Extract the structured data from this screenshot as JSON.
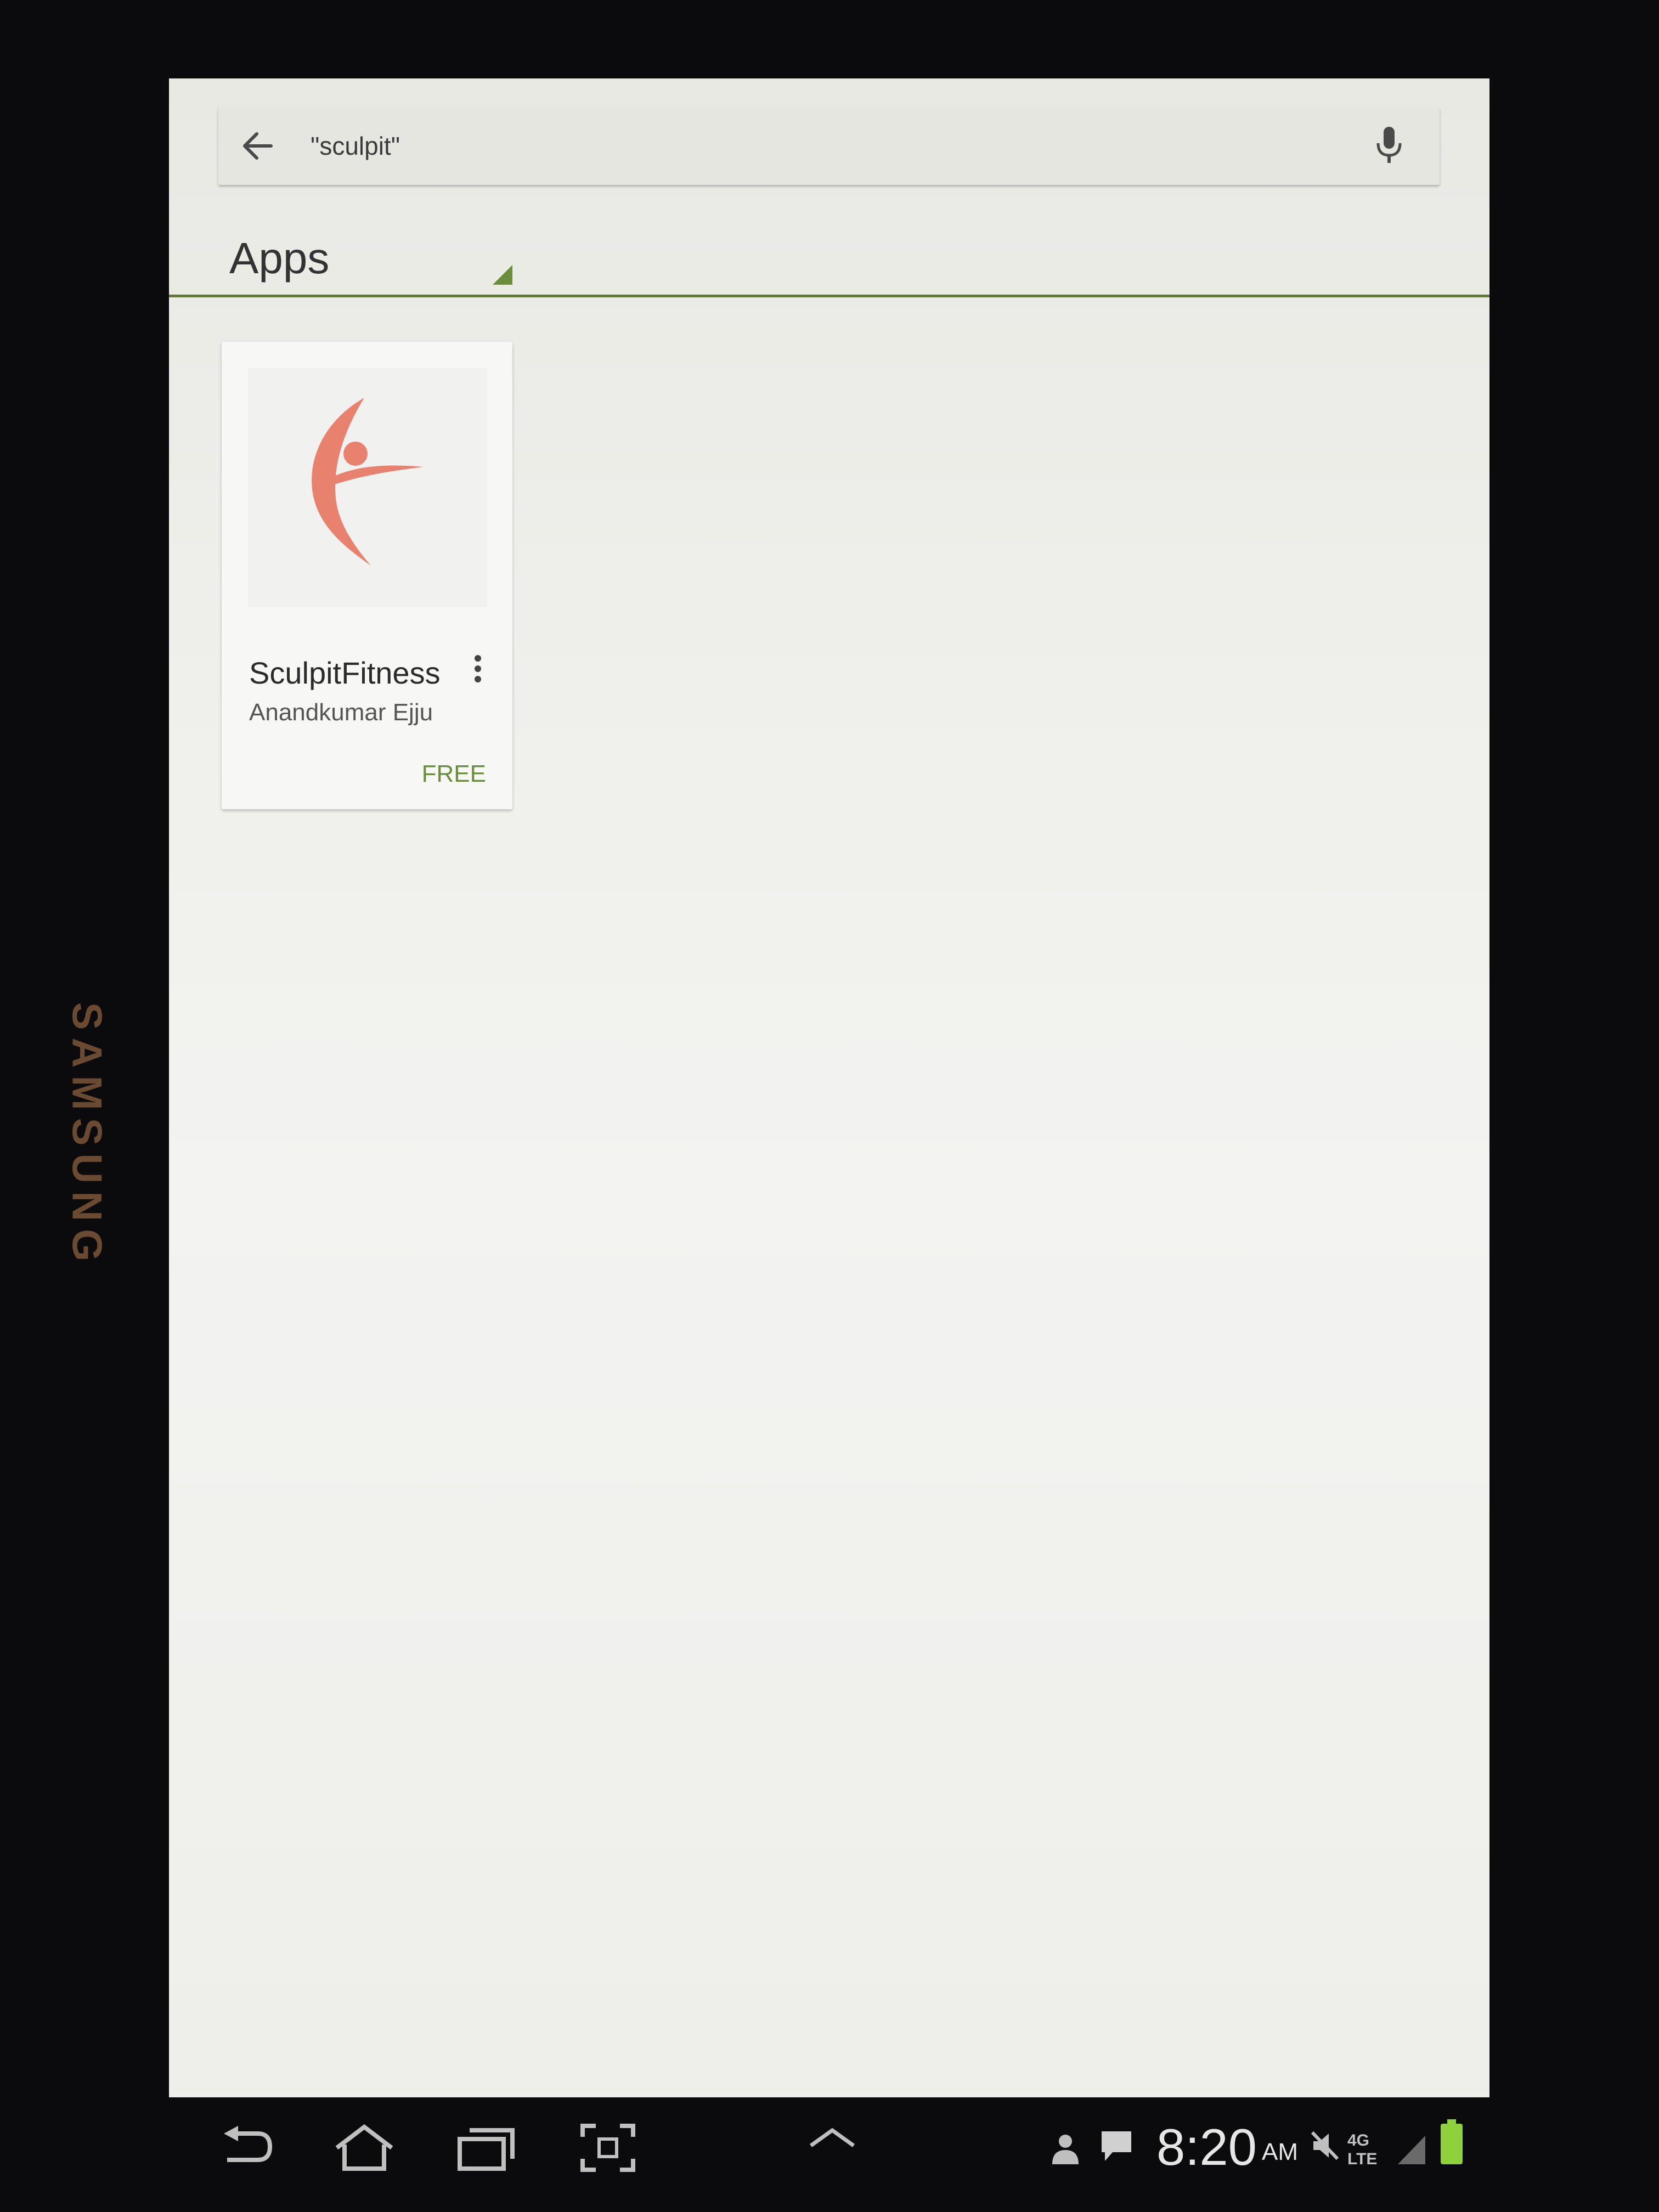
{
  "device": {
    "brand": "SAMSUNG"
  },
  "search": {
    "query": "\"sculpit\""
  },
  "tab": {
    "title": "Apps"
  },
  "results": [
    {
      "name": "SculpitFitness",
      "developer": "Anandkumar Ejju",
      "price": "FREE",
      "icon": "dancing-figure-logo"
    }
  ],
  "status_bar": {
    "time": "8:20",
    "ampm": "AM",
    "network": "4G LTE",
    "icons": [
      "person-icon",
      "message-icon",
      "mute-icon",
      "signal-icon",
      "battery-icon"
    ]
  },
  "nav_bar": {
    "icons": [
      "back-icon",
      "home-icon",
      "recent-apps-icon",
      "screenshot-icon",
      "expand-up-icon"
    ]
  },
  "colors": {
    "accent": "#6b8e3b",
    "tab_underline": "#5f7a34",
    "logo": "#e8826e"
  }
}
